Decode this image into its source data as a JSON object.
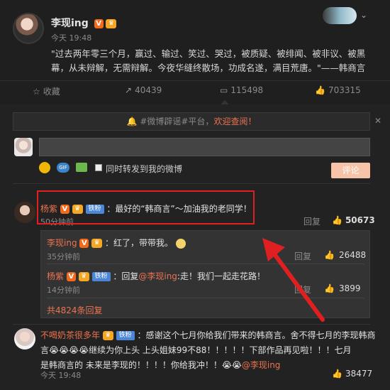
{
  "post": {
    "author": "李现ing",
    "time": "今天 19:48",
    "text1": "\"过去两年零三个月，赢过、输过、笑过、哭过，被质疑、被绯闻、被非议、被黑",
    "text2": "幕，从未辩解，无需辩解。今夜华缝终散场，功成名遂，满目荒唐。\"——韩商言"
  },
  "actions": {
    "collect": "收藏",
    "repost": "40439",
    "comment": "115498",
    "like": "703315"
  },
  "notice": {
    "text": "#微博辟谣#平台，",
    "link": "欢迎查阅！"
  },
  "composer": {
    "share_label": "同时转发到我的微博",
    "submit": "评论"
  },
  "comment1": {
    "user": "杨紫",
    "badge": "铁粉",
    "text": "：最好的“韩商言”～加油我的老同学！",
    "time": "50分钟前",
    "reply": "回复",
    "likes": "50673"
  },
  "reply1": {
    "user": "李现ing",
    "text": "：红了，带带我。",
    "time": "35分钟前",
    "reply": "回复",
    "likes": "26488"
  },
  "reply2": {
    "user": "杨紫",
    "badge": "铁粉",
    "prefix": "：回复",
    "mention": "@李现ing",
    "text": ":走！我们一起走花路！",
    "time": "14分钟前",
    "reply": "回复",
    "likes": "3899"
  },
  "more_replies": "共4824条回复",
  "comment2": {
    "user": "不喝奶茶很多年",
    "badge": "铁粉",
    "text1": "：感谢这个七月你给我们带来的韩商言。舍不得七月的李现韩商",
    "text2": "言😭😭😭😭继续为你上头 上头姐妹99不88！！！！！下部作品再见啦！！！七月",
    "text3": "是韩商言的 未来是李现的！！！！你给我冲！！😭😭",
    "mention": "@李现ing",
    "time": "今天 19:48",
    "likes": "38477"
  }
}
